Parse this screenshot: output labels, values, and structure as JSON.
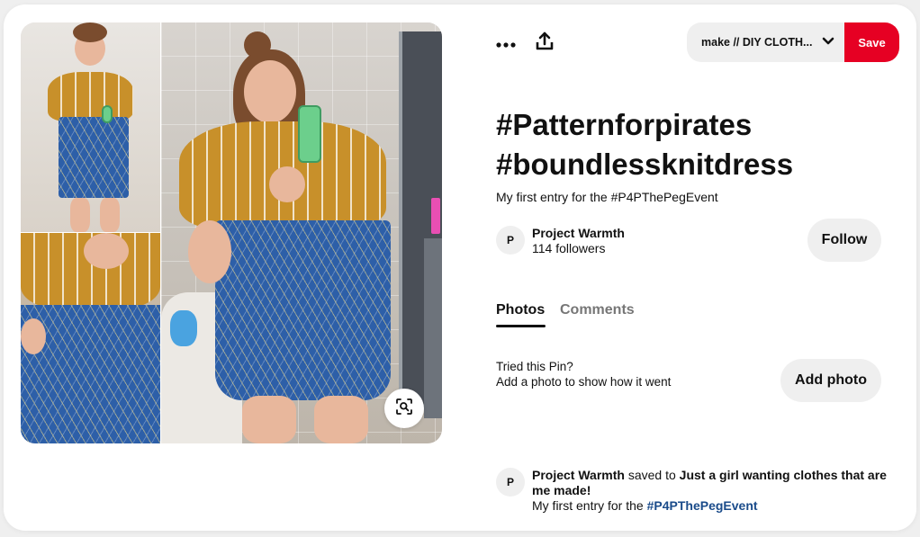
{
  "toolbar": {
    "more_icon": "more-horizontal-icon",
    "share_icon": "share-upload-icon"
  },
  "board_select": {
    "value": "make // DIY CLOTH...",
    "icon": "chevron-down-icon"
  },
  "save_button": {
    "label": "Save",
    "color": "#e60023"
  },
  "pin": {
    "title_line1": "#Patternforpirates",
    "title_line2": "#boundlessknitdress",
    "description": "My first entry for the #P4PThePegEvent"
  },
  "creator": {
    "avatar_initial": "P",
    "name": "Project Warmth",
    "followers": "114 followers",
    "follow_label": "Follow"
  },
  "tabs": {
    "photos": "Photos",
    "comments": "Comments",
    "active": "Photos"
  },
  "tried": {
    "line1": "Tried this Pin?",
    "line2": "Add a photo to show how it went",
    "add_photo_label": "Add photo"
  },
  "activity": {
    "avatar_initial": "P",
    "user": "Project Warmth",
    "verb": "saved to",
    "board": "Just a girl wanting clothes that are me made!",
    "desc_prefix": "My first entry for the",
    "hashtag": "#P4PThePegEvent"
  },
  "media": {
    "lens_icon": "visual-search-icon"
  }
}
